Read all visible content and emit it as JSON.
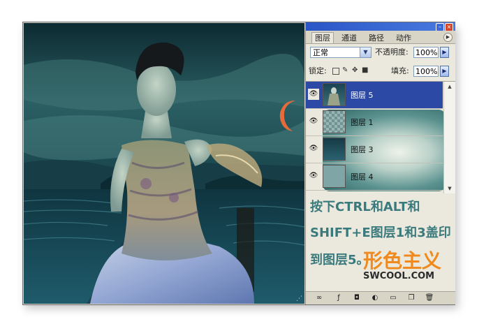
{
  "palette": {
    "tabs": [
      "图层",
      "通道",
      "路径",
      "动作"
    ],
    "blend_mode": "正常",
    "opacity_label": "不透明度:",
    "opacity_value": "100%",
    "lock_label": "锁定:",
    "fill_label": "填充:",
    "fill_value": "100%",
    "layers": [
      {
        "name": "图层 5",
        "selected": true
      },
      {
        "name": "图层 1",
        "selected": false
      },
      {
        "name": "图层 3",
        "selected": false
      },
      {
        "name": "图层 4",
        "selected": false
      }
    ]
  },
  "instructions": [
    "按下CTRL和ALT和",
    "SHIFT+E图层1和3盖印",
    "到图层5。"
  ],
  "brand": {
    "logo_text": "形色主义",
    "url": "SWCOOL.COM"
  },
  "colors": {
    "accent": "#2d49a6",
    "instruction_text": "#3a7a7d",
    "brand": "#f08a1e"
  }
}
